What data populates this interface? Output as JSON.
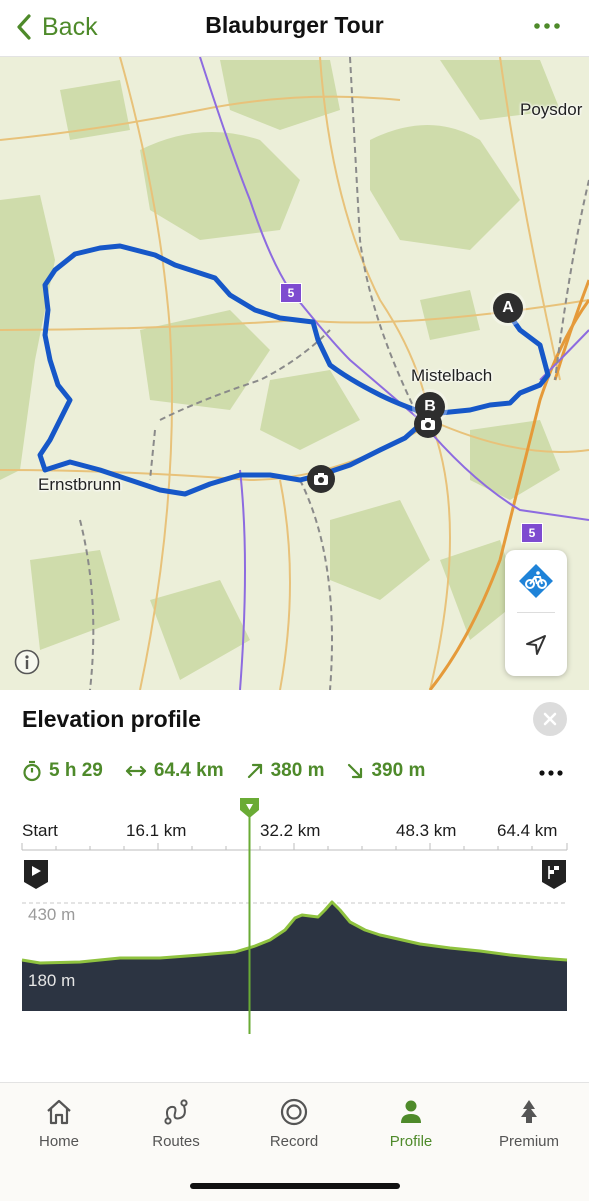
{
  "header": {
    "back_label": "Back",
    "title": "Blauburger Tour"
  },
  "map": {
    "places": {
      "poysdorf": "Poysdor",
      "mistelbach": "Mistelbach",
      "ernstbrunn": "Ernstbrunn"
    },
    "start_marker": "A",
    "end_marker": "B",
    "route_shield": "5",
    "route_color": "#1657c8"
  },
  "elevation": {
    "title": "Elevation profile",
    "duration": "5 h 29",
    "distance": "64.4 km",
    "ascent": "380 m",
    "descent": "390 m",
    "distance_marks": [
      "Start",
      "16.1 km",
      "32.2 km",
      "48.3 km",
      "64.4 km"
    ],
    "high_label": "430 m",
    "low_label": "180 m",
    "accent_color": "#6aab35"
  },
  "tabs": [
    {
      "label": "Home",
      "icon": "home-icon"
    },
    {
      "label": "Routes",
      "icon": "routes-icon"
    },
    {
      "label": "Record",
      "icon": "record-icon"
    },
    {
      "label": "Profile",
      "icon": "profile-icon",
      "active": true
    },
    {
      "label": "Premium",
      "icon": "premium-icon"
    }
  ]
}
